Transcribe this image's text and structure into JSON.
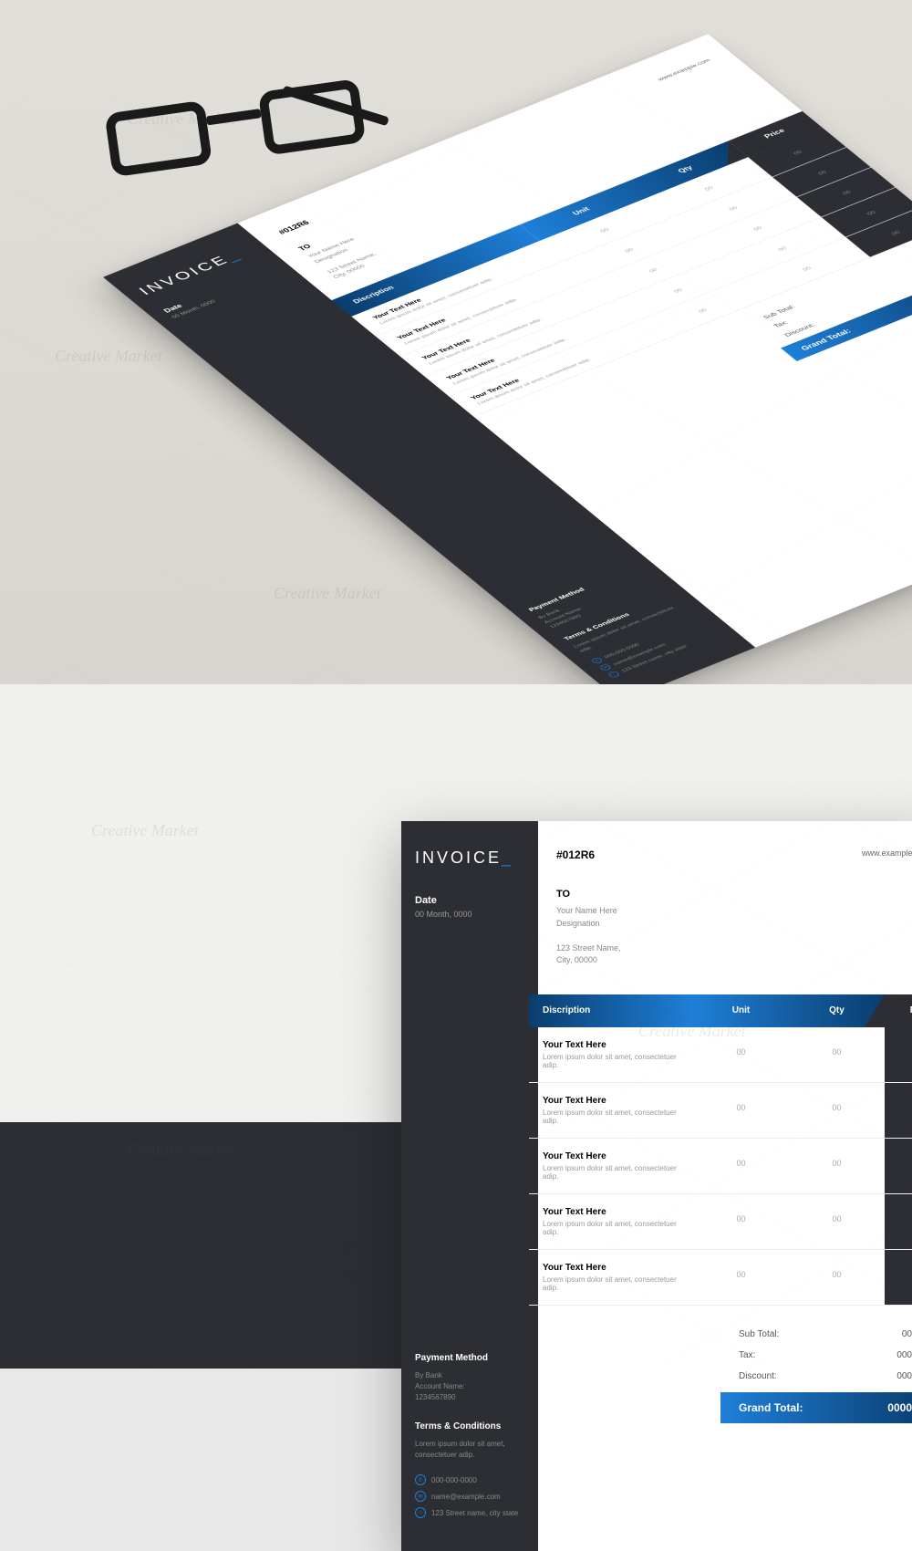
{
  "invoice": {
    "title": "INVOICE",
    "dash": "_",
    "date_label": "Date",
    "date_value": "00 Month, 0000",
    "number": "#012R6",
    "website": "www.example.com",
    "to_label": "TO",
    "to_name": "Your Name Here",
    "to_designation": "Designation",
    "to_address1": "123 Street Name,",
    "to_address2": "City, 00000",
    "columns": {
      "description": "Discription",
      "unit": "Unit",
      "qty": "Qty",
      "price": "Price"
    },
    "rows": [
      {
        "title": "Your Text Here",
        "sub": "Lorem ipsum dolor sit amet, consectetuer adip.",
        "unit": "00",
        "qty": "00",
        "price": "00"
      },
      {
        "title": "Your Text Here",
        "sub": "Lorem ipsum dolor sit amet, consectetuer adip.",
        "unit": "00",
        "qty": "00",
        "price": "00"
      },
      {
        "title": "Your Text Here",
        "sub": "Lorem ipsum dolor sit amet, consectetuer adip.",
        "unit": "00",
        "qty": "00",
        "price": "00"
      },
      {
        "title": "Your Text Here",
        "sub": "Lorem ipsum dolor sit amet, consectetuer adip.",
        "unit": "00",
        "qty": "00",
        "price": "00"
      },
      {
        "title": "Your Text Here",
        "sub": "Lorem ipsum dolor sit amet, consectetuer adip.",
        "unit": "00",
        "qty": "00",
        "price": "00"
      }
    ],
    "totals": {
      "subtotal_label": "Sub Total:",
      "subtotal_value": "00",
      "tax_label": "Tax:",
      "tax_value": "000",
      "discount_label": "Discount:",
      "discount_value": "000",
      "grand_label": "Grand Total:",
      "grand_value": "0000"
    },
    "payment": {
      "label": "Payment Method",
      "line1": "By Bank",
      "line2": "Account Name:",
      "line3": "1234567890"
    },
    "terms": {
      "label": "Terms & Conditions",
      "text": "Lorem ipsum dolor sit amet, consectetuer adip."
    },
    "contact": {
      "phone": "000-000-0000",
      "email": "name@example.com",
      "address": "123 Street name, city state"
    }
  },
  "watermark": "Creative Market"
}
